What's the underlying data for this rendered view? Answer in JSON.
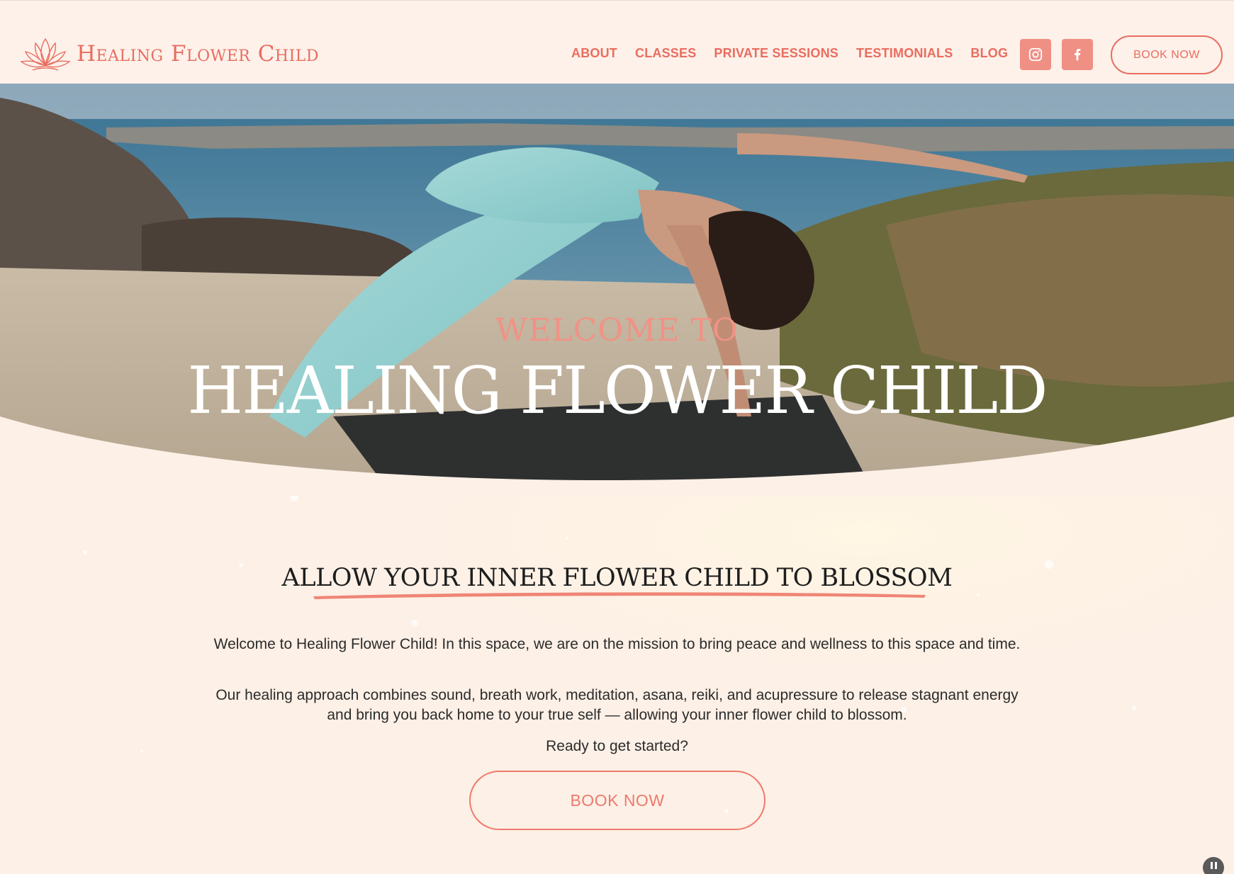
{
  "brand": {
    "name": "Healing Flower Child"
  },
  "nav": {
    "items": [
      {
        "label": "ABOUT"
      },
      {
        "label": "CLASSES"
      },
      {
        "label": "PRIVATE SESSIONS"
      },
      {
        "label": "TESTIMONIALS"
      },
      {
        "label": "BLOG"
      }
    ],
    "social": [
      {
        "icon": "instagram-icon"
      },
      {
        "icon": "facebook-icon"
      }
    ],
    "book_label": "BOOK NOW"
  },
  "hero": {
    "welcome": "WELCOME TO",
    "title": "HEALING FLOWER CHILD"
  },
  "main": {
    "heading": "ALLOW YOUR INNER FLOWER CHILD TO BLOSSOM",
    "paragraphs": [
      "Welcome to Healing Flower Child! In this space, we are on the mission to bring peace and wellness to this space and time.",
      "Our healing approach combines sound, breath work, meditation, asana, reiki, and acupressure to release stagnant energy and bring you back home to your true self — allowing your inner flower child to blossom.",
      "Ready to get started?"
    ],
    "book_label": "BOOK NOW"
  },
  "colors": {
    "accent": "#e96d5f",
    "header_bg": "#fdf1ea",
    "page_bg": "#fdf0e6",
    "social_bg": "#f08f84"
  }
}
